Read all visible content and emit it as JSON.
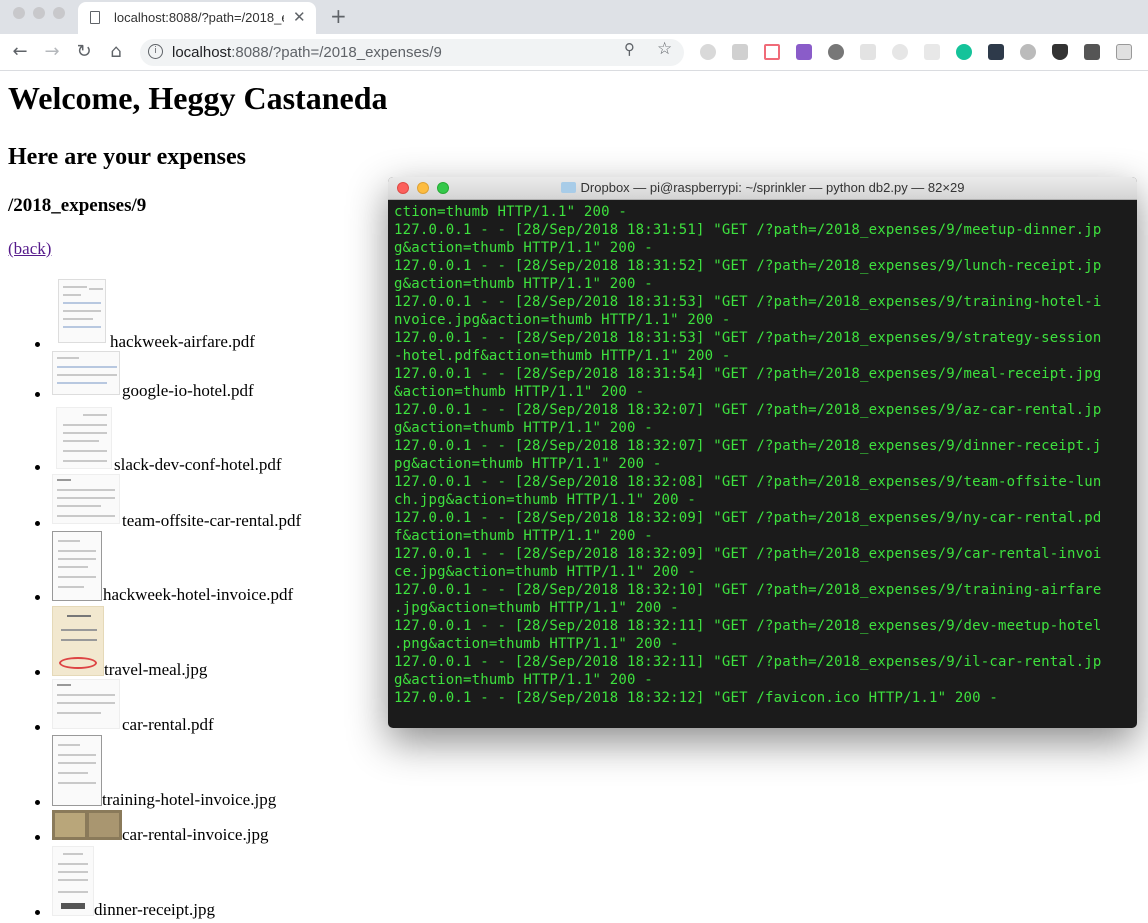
{
  "browser": {
    "tab_title": "localhost:8088/?path=/2018_e",
    "url_host": "localhost",
    "url_rest": ":8088/?path=/2018_expenses/9"
  },
  "page": {
    "welcome": "Welcome, Heggy Castaneda",
    "subtitle": "Here are your expenses",
    "folder": "/2018_expenses/9",
    "back": "(back)",
    "files": [
      "hackweek-airfare.pdf",
      "google-io-hotel.pdf",
      "slack-dev-conf-hotel.pdf",
      "team-offsite-car-rental.pdf",
      "hackweek-hotel-invoice.pdf",
      "travel-meal.jpg",
      "car-rental.pdf",
      "training-hotel-invoice.jpg",
      "car-rental-invoice.jpg",
      "dinner-receipt.jpg"
    ]
  },
  "terminal": {
    "title": "Dropbox — pi@raspberrypi: ~/sprinkler — python db2.py — 82×29",
    "lines": [
      "ction=thumb HTTP/1.1\" 200 -",
      "127.0.0.1 - - [28/Sep/2018 18:31:51] \"GET /?path=/2018_expenses/9/meetup-dinner.jp",
      "g&action=thumb HTTP/1.1\" 200 -",
      "127.0.0.1 - - [28/Sep/2018 18:31:52] \"GET /?path=/2018_expenses/9/lunch-receipt.jp",
      "g&action=thumb HTTP/1.1\" 200 -",
      "127.0.0.1 - - [28/Sep/2018 18:31:53] \"GET /?path=/2018_expenses/9/training-hotel-i",
      "nvoice.jpg&action=thumb HTTP/1.1\" 200 -",
      "127.0.0.1 - - [28/Sep/2018 18:31:53] \"GET /?path=/2018_expenses/9/strategy-session",
      "-hotel.pdf&action=thumb HTTP/1.1\" 200 -",
      "127.0.0.1 - - [28/Sep/2018 18:31:54] \"GET /?path=/2018_expenses/9/meal-receipt.jpg",
      "&action=thumb HTTP/1.1\" 200 -",
      "127.0.0.1 - - [28/Sep/2018 18:32:07] \"GET /?path=/2018_expenses/9/az-car-rental.jp",
      "g&action=thumb HTTP/1.1\" 200 -",
      "127.0.0.1 - - [28/Sep/2018 18:32:07] \"GET /?path=/2018_expenses/9/dinner-receipt.j",
      "pg&action=thumb HTTP/1.1\" 200 -",
      "127.0.0.1 - - [28/Sep/2018 18:32:08] \"GET /?path=/2018_expenses/9/team-offsite-lun",
      "ch.jpg&action=thumb HTTP/1.1\" 200 -",
      "127.0.0.1 - - [28/Sep/2018 18:32:09] \"GET /?path=/2018_expenses/9/ny-car-rental.pd",
      "f&action=thumb HTTP/1.1\" 200 -",
      "127.0.0.1 - - [28/Sep/2018 18:32:09] \"GET /?path=/2018_expenses/9/car-rental-invoi",
      "ce.jpg&action=thumb HTTP/1.1\" 200 -",
      "127.0.0.1 - - [28/Sep/2018 18:32:10] \"GET /?path=/2018_expenses/9/training-airfare",
      ".jpg&action=thumb HTTP/1.1\" 200 -",
      "127.0.0.1 - - [28/Sep/2018 18:32:11] \"GET /?path=/2018_expenses/9/dev-meetup-hotel",
      ".png&action=thumb HTTP/1.1\" 200 -",
      "127.0.0.1 - - [28/Sep/2018 18:32:11] \"GET /?path=/2018_expenses/9/il-car-rental.jp",
      "g&action=thumb HTTP/1.1\" 200 -",
      "127.0.0.1 - - [28/Sep/2018 18:32:12] \"GET /favicon.ico HTTP/1.1\" 200 -"
    ]
  },
  "colors": {
    "terminal_text": "#3ee13e",
    "terminal_bg": "#1b1b1b",
    "visited_link": "#551a8b"
  }
}
